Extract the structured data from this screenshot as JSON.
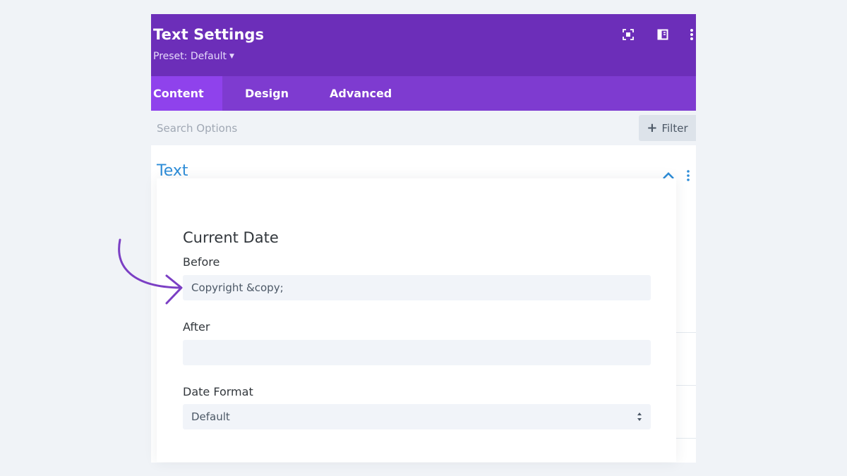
{
  "header": {
    "title": "Text Settings",
    "preset": "Preset: Default",
    "icons": [
      "focus-mode-icon",
      "split-view-icon",
      "more-vertical-icon"
    ]
  },
  "tabs": [
    {
      "label": "Content",
      "active": true
    },
    {
      "label": "Design",
      "active": false
    },
    {
      "label": "Advanced",
      "active": false
    }
  ],
  "search": {
    "placeholder": "Search Options",
    "filter_label": "Filter"
  },
  "section": {
    "title": "Text",
    "state": "expanded"
  },
  "card": {
    "title": "Current Date",
    "fields": {
      "before": {
        "label": "Before",
        "value": "Copyright &copy;"
      },
      "after": {
        "label": "After",
        "value": ""
      },
      "date_format": {
        "label": "Date Format",
        "value": "Default"
      }
    }
  },
  "colors": {
    "header": "#6c2eb9",
    "tabs": "#7e3bd0",
    "active_tab": "#8f42ec",
    "section_title": "#2e8dd8",
    "annotation_arrow": "#7b3fc4"
  }
}
